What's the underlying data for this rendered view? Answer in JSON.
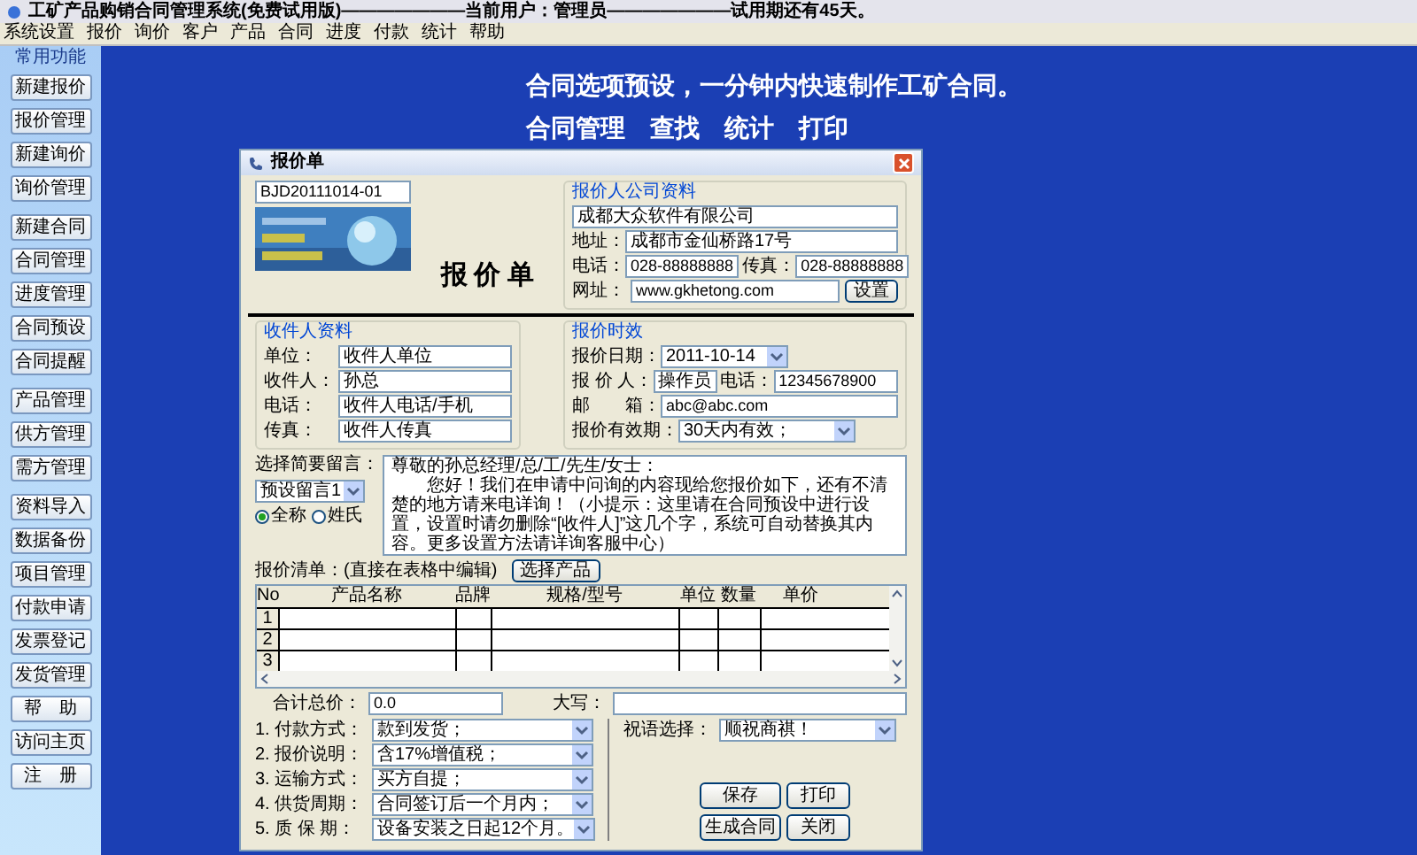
{
  "window": {
    "title": "工矿产品购销合同管理系统(免费试用版)———————当前用户：管理员———————试用期还有45天。"
  },
  "menu": [
    "系统设置",
    "报价",
    "询价",
    "客户",
    "产品",
    "合同",
    "进度",
    "付款",
    "统计",
    "帮助"
  ],
  "sidebar": {
    "heading": "常用功能",
    "groups": [
      [
        "新建报价",
        "报价管理",
        "新建询价",
        "询价管理"
      ],
      [
        "新建合同",
        "合同管理",
        "进度管理",
        "合同预设",
        "合同提醒"
      ],
      [
        "产品管理",
        "供方管理",
        "需方管理"
      ],
      [
        "资料导入",
        "数据备份",
        "项目管理",
        "付款申请",
        "发票登记",
        "发货管理",
        "帮　助",
        "访问主页",
        "注　册"
      ]
    ]
  },
  "banner": [
    "合同选项预设，一分钟内快速制作工矿合同。",
    "合同管理　查找　统计　打印"
  ],
  "dialog": {
    "title": "报价单",
    "quote_no": "BJD20111014-01",
    "heading": "报 价 单",
    "company": {
      "legend": "报价人公司资料",
      "name": "成都大众软件有限公司",
      "address_label": "地址：",
      "address": "成都市金仙桥路17号",
      "phone_label": "电话：",
      "phone": "028-88888888",
      "fax_label": "传真：",
      "fax": "028-88888888",
      "web_label": "网址：",
      "web": "www.gkhetong.com",
      "button": "设置"
    },
    "recipient": {
      "legend": "收件人资料",
      "fields": [
        {
          "label": "单位：",
          "value": "收件人单位"
        },
        {
          "label": "收件人：",
          "value": "孙总"
        },
        {
          "label": "电话：",
          "value": "收件人电话/手机"
        },
        {
          "label": "传真：",
          "value": "收件人传真"
        }
      ]
    },
    "validity": {
      "legend": "报价时效",
      "date_label": "报价日期：",
      "date": "2011-10-14",
      "person_label": "报 价 人：",
      "person": "操作员",
      "phone_label": "电话：",
      "phone": "12345678900",
      "email_label": "邮　　箱：",
      "email": "abc@abc.com",
      "period_label": "报价有效期：",
      "period": "30天内有效；"
    },
    "message": {
      "label": "选择简要留言：",
      "preset": "预设留言1",
      "options": [
        {
          "label": "全称",
          "selected": true
        },
        {
          "label": "姓氏",
          "selected": false
        }
      ],
      "salutation": "尊敬的孙总经理/总/工/先生/女士：",
      "text": "您好！我们在申请中问询的内容现给您报价如下，还有不清楚的地方请来电详询！（小提示：这里请在合同预设中进行设置，设置时请勿删除“[收件人]”这几个字，系统可自动替换其内容。更多设置方法请详询客服中心）"
    },
    "list": {
      "label": "报价清单：(直接在表格中编辑)",
      "button": "选择产品",
      "columns": [
        "No",
        "产品名称",
        "品牌",
        "规格/型号",
        "单位",
        "数量",
        "单价"
      ],
      "rows": [
        "1",
        "2",
        "3"
      ]
    },
    "total": {
      "label": "合计总价：",
      "value": "0.0",
      "caps_label": "大写："
    },
    "terms": [
      {
        "label": "1. 付款方式：",
        "value": "款到发货；"
      },
      {
        "label": "2. 报价说明：",
        "value": "含17%增值税；"
      },
      {
        "label": "3. 运输方式：",
        "value": "买方自提；"
      },
      {
        "label": "4. 供货周期：",
        "value": "合同签订后一个月内；"
      },
      {
        "label": "5. 质 保 期：",
        "value": "设备安装之日起12个月。"
      }
    ],
    "greeting": {
      "label": "祝语选择：",
      "value": "顺祝商祺！"
    },
    "buttons": [
      "保存",
      "打印",
      "生成合同",
      "关闭"
    ]
  }
}
